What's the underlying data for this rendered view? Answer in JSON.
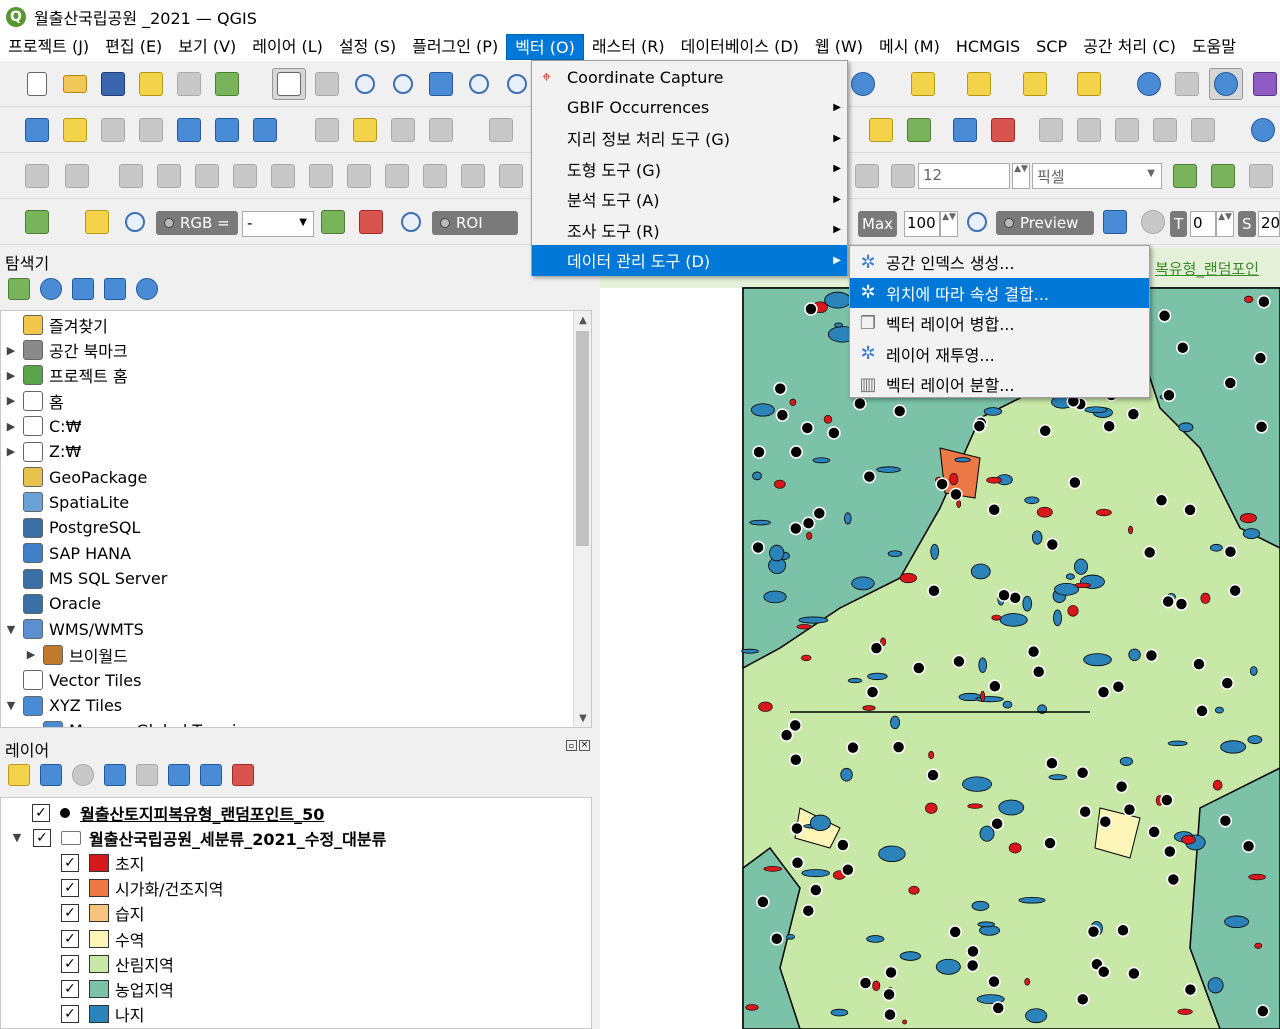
{
  "window": {
    "title": "월출산국립공원 _2021 — QGIS",
    "logo_letter": "Q"
  },
  "menubar": [
    {
      "label": "프로젝트 (J)"
    },
    {
      "label": "편집 (E)"
    },
    {
      "label": "보기 (V)"
    },
    {
      "label": "레이어 (L)"
    },
    {
      "label": "설정 (S)"
    },
    {
      "label": "플러그인 (P)"
    },
    {
      "label": "벡터 (O)"
    },
    {
      "label": "래스터 (R)"
    },
    {
      "label": "데이터베이스 (D)"
    },
    {
      "label": "웹 (W)"
    },
    {
      "label": "메시 (M)"
    },
    {
      "label": "HCMGIS"
    },
    {
      "label": "SCP"
    },
    {
      "label": "공간 처리 (C)"
    },
    {
      "label": "도움말"
    }
  ],
  "vector_menu": {
    "items": [
      {
        "label": "Coordinate Capture",
        "submenu": false
      },
      {
        "label": "GBIF Occurrences",
        "submenu": true
      },
      {
        "label": "지리 정보 처리 도구 (G)",
        "submenu": true
      },
      {
        "label": "도형 도구 (G)",
        "submenu": true
      },
      {
        "label": "분석 도구 (A)",
        "submenu": true
      },
      {
        "label": "조사 도구 (R)",
        "submenu": true
      },
      {
        "label": "데이터 관리 도구 (D)",
        "submenu": true
      }
    ],
    "submenu_glyph": "▶"
  },
  "data_management_submenu": {
    "items": [
      {
        "label": "공간 인덱스 생성...",
        "icon": "gear-icon"
      },
      {
        "label": "위치에 따라 속성 결합...",
        "icon": "gear-icon"
      },
      {
        "label": "벡터 레이어 병합...",
        "icon": "merge-icon"
      },
      {
        "label": "레이어 재투영...",
        "icon": "gear-icon"
      },
      {
        "label": "벡터 레이어 분할...",
        "icon": "split-icon"
      }
    ]
  },
  "toolbar": {
    "label_size": "12",
    "unit": "픽셀",
    "rgb_label": "RGB =",
    "rgb_value": "-",
    "roi_label": "ROI",
    "max_label": "Max",
    "max_value": "100",
    "preview_label": "Preview",
    "t_label": "T",
    "t_value": "0",
    "s_label": "S",
    "s_value": "20"
  },
  "browser_panel": {
    "title": "탐색기",
    "items": [
      {
        "label": "즐겨찾기",
        "arrow": "",
        "icon": "star-icon"
      },
      {
        "label": "공간 북마크",
        "arrow": "▶",
        "icon": "bookmark-icon"
      },
      {
        "label": "프로젝트 홈",
        "arrow": "▶",
        "icon": "project-home-icon"
      },
      {
        "label": "홈",
        "arrow": "▶",
        "icon": "home-icon"
      },
      {
        "label": "C:₩",
        "arrow": "▶",
        "icon": "drive-icon"
      },
      {
        "label": "Z:₩",
        "arrow": "▶",
        "icon": "drive-icon"
      },
      {
        "label": "GeoPackage",
        "arrow": "",
        "icon": "geopackage-icon"
      },
      {
        "label": "SpatiaLite",
        "arrow": "",
        "icon": "spatialite-icon"
      },
      {
        "label": "PostgreSQL",
        "arrow": "",
        "icon": "postgresql-icon"
      },
      {
        "label": "SAP HANA",
        "arrow": "",
        "icon": "hana-icon"
      },
      {
        "label": "MS SQL Server",
        "arrow": "",
        "icon": "mssql-icon"
      },
      {
        "label": "Oracle",
        "arrow": "",
        "icon": "oracle-icon"
      },
      {
        "label": "WMS/WMTS",
        "arrow": "▼",
        "icon": "globe-icon"
      },
      {
        "label": "브이월드",
        "arrow": "▶",
        "icon": "wms-connection-icon",
        "indent": true
      },
      {
        "label": "Vector Tiles",
        "arrow": "",
        "icon": "vector-tiles-icon"
      },
      {
        "label": "XYZ Tiles",
        "arrow": "▼",
        "icon": "xyz-tiles-icon"
      },
      {
        "label": "Mapzen Global Terrain",
        "arrow": "",
        "icon": "xyz-tiles-icon",
        "indent": true
      }
    ]
  },
  "layers_panel": {
    "title": "레이어",
    "layers": [
      {
        "label": "월출산토지피복유형_랜덤포인트_50",
        "type": "point",
        "checked": true
      },
      {
        "label": "월출산국립공원_세분류_2021_수정_대분류",
        "type": "polygon",
        "checked": true
      }
    ],
    "classes": [
      {
        "label": "초지",
        "color": "#d7191c"
      },
      {
        "label": "시가화/건조지역",
        "color": "#ec7845"
      },
      {
        "label": "습지",
        "color": "#f9c27e"
      },
      {
        "label": "수역",
        "color": "#fdf5b8"
      },
      {
        "label": "산림지역",
        "color": "#c7e8a6"
      },
      {
        "label": "농업지역",
        "color": "#7cc2a9"
      },
      {
        "label": "나지",
        "color": "#2b83ba"
      }
    ],
    "check_glyph": "✓"
  },
  "map": {
    "banner_text": "복유형_랜덤포인",
    "colors": {
      "forest": "#c7e8a6",
      "agri": "#7cc2a9",
      "water": "#2b83ba",
      "grass": "#d7191c",
      "urban": "#ec7845",
      "wetland": "#fdf5b8"
    }
  }
}
